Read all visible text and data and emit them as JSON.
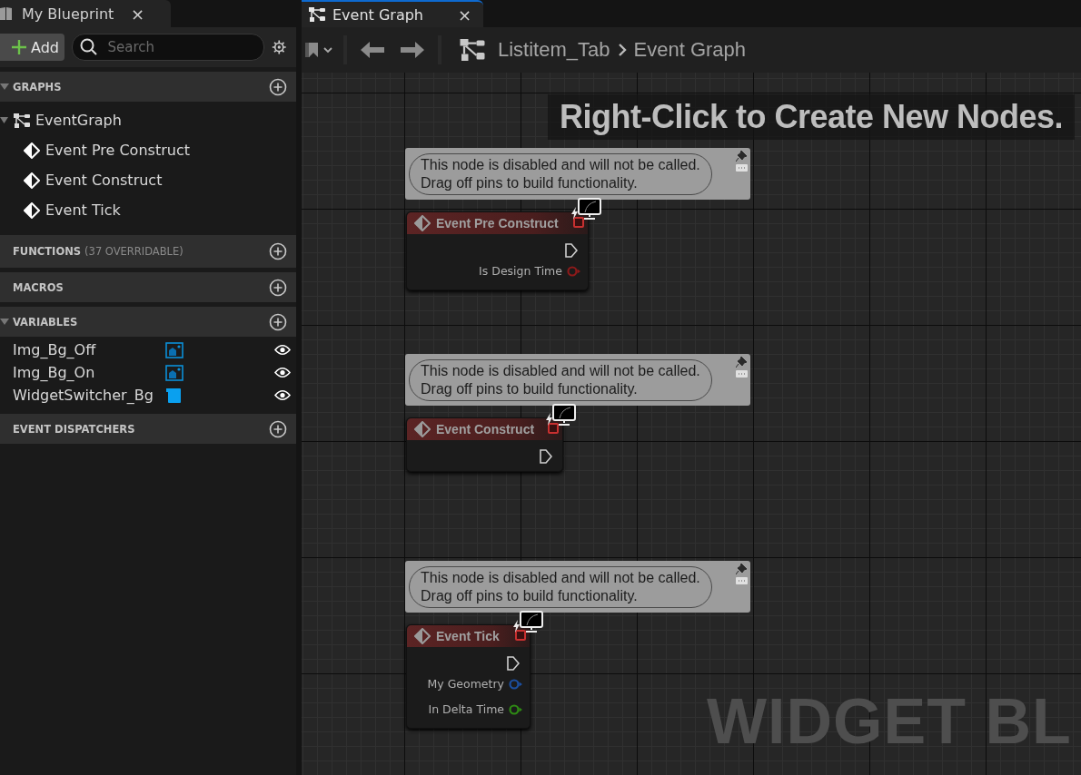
{
  "left_panel": {
    "tab": {
      "title": "My Blueprint",
      "close": "×"
    },
    "add_button": "Add",
    "search": {
      "placeholder": "Search"
    },
    "sections": [
      {
        "title": "GRAPHS",
        "expanded": true,
        "tree": [
          {
            "label": "EventGraph",
            "kind": "graph",
            "children": [
              {
                "label": "Event Pre Construct",
                "kind": "event"
              },
              {
                "label": "Event Construct",
                "kind": "event"
              },
              {
                "label": "Event Tick",
                "kind": "event"
              }
            ]
          }
        ]
      },
      {
        "title": "FUNCTIONS",
        "note": "(37 OVERRIDABLE)",
        "expanded": false
      },
      {
        "title": "MACROS",
        "expanded": false
      },
      {
        "title": "VARIABLES",
        "expanded": true,
        "variables": [
          {
            "name": "Img_Bg_Off",
            "kind": "image",
            "visible": true
          },
          {
            "name": "Img_Bg_On",
            "kind": "image",
            "visible": true
          },
          {
            "name": "WidgetSwitcher_Bg",
            "kind": "switcher",
            "visible": true
          }
        ]
      },
      {
        "title": "EVENT DISPATCHERS",
        "expanded": false
      }
    ]
  },
  "editor": {
    "tabs": [
      {
        "title": "Event Graph",
        "close": "×",
        "selected": true
      }
    ],
    "breadcrumb": [
      "Listitem_Tab",
      "Event Graph"
    ],
    "hint": "Right-Click to Create New Nodes.",
    "watermark": "WIDGET BL",
    "nodes": [
      {
        "comment": "This node is disabled and will not be called.\nDrag off pins to build functionality.",
        "title": "Event Pre Construct",
        "disabled": true,
        "outputs": [
          {
            "label": "Is Design Time",
            "color": "#8c1a1a"
          }
        ]
      },
      {
        "comment": "This node is disabled and will not be called.\nDrag off pins to build functionality.",
        "title": "Event Construct",
        "disabled": true
      },
      {
        "comment": "This node is disabled and will not be called.\nDrag off pins to build functionality.",
        "title": "Event Tick",
        "disabled": true,
        "outputs": [
          {
            "label": "My Geometry",
            "color": "#1c4fa0"
          },
          {
            "label": "In Delta Time",
            "color": "#2e8a14"
          }
        ]
      }
    ]
  }
}
